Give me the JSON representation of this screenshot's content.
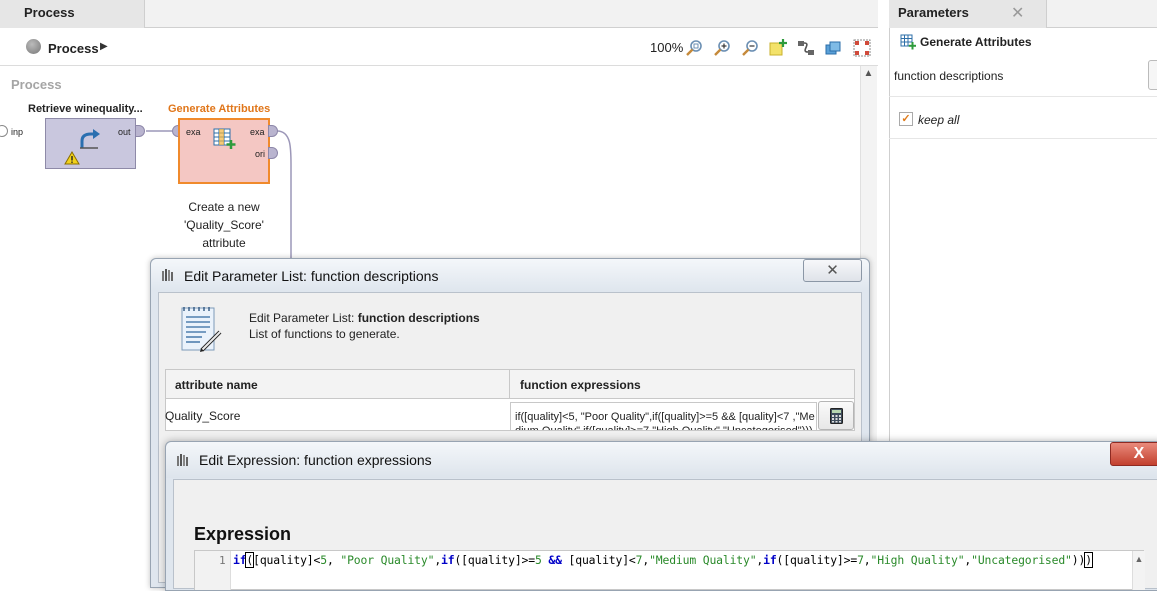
{
  "process_panel": {
    "tab_label": "Process",
    "breadcrumb": "Process",
    "zoom_level": "100%",
    "canvas_title": "Process",
    "left_port_label": "inp",
    "operators": [
      {
        "name": "Retrieve winequality...",
        "ports_out": [
          "out"
        ]
      },
      {
        "name": "Generate Attributes",
        "ports_in": [
          "exa"
        ],
        "ports_out": [
          "exa",
          "ori"
        ],
        "note": "Create a new 'Quality_Score' attribute"
      }
    ]
  },
  "parameters_panel": {
    "tab_label": "Parameters",
    "close_glyph": "✕",
    "operator_name": "Generate Attributes",
    "function_descriptions_label": "function descriptions",
    "keep_all_label": "keep all",
    "keep_all_checked": true,
    "check_glyph": "✓"
  },
  "edit_list_dialog": {
    "title": "Edit Parameter List: function descriptions",
    "close_glyph": "✕",
    "heading_prefix": "Edit Parameter List: ",
    "heading_bold": "function descriptions",
    "subheading": "List of functions to generate.",
    "columns": [
      "attribute name",
      "function expressions"
    ],
    "rows": [
      {
        "attribute_name": "Quality_Score",
        "function_expression": "if([quality]<5, \"Poor Quality\",if([quality]>=5 && [quality]<7 ,\"Medium Quality\",if([quality]>=7,\"High Quality\",\"Uncategorised\")))"
      }
    ]
  },
  "edit_expression_dialog": {
    "title": "Edit Expression: function expressions",
    "close_glyph": "X",
    "expression_label": "Expression",
    "line_number": "1",
    "scroll_up_glyph": "▲",
    "tokens": {
      "kw_if": "if",
      "open_paren": "(",
      "close_paren": ")",
      "quality": "[quality]",
      "op_lt": "<",
      "op_ge": ">=",
      "op_and": "&&",
      "num_5": "5",
      "num_7": "7",
      "comma": ",",
      "str_poor": "\"Poor Quality\"",
      "str_medium": "\"Medium Quality\"",
      "str_high": "\"High Quality\"",
      "str_uncat": "\"Uncategorised\""
    }
  },
  "colors": {
    "accent_orange": "#f08a2c",
    "operator_purple": "#c9c7de",
    "operator_pink": "#f4c7c3",
    "keyword_blue": "#0000c8",
    "string_green": "#2a8a2a",
    "close_red": "#c2402e"
  },
  "icons": [
    "globe-icon",
    "chevron-right-icon",
    "zoom-fit-icon",
    "zoom-in-icon",
    "zoom-out-icon",
    "add-note-icon",
    "auto-wire-icon",
    "layers-icon",
    "arrange-icon",
    "retrieve-arrow-icon",
    "warning-icon",
    "table-plus-icon",
    "dialog-app-icon",
    "document-edit-icon",
    "calculator-icon"
  ]
}
